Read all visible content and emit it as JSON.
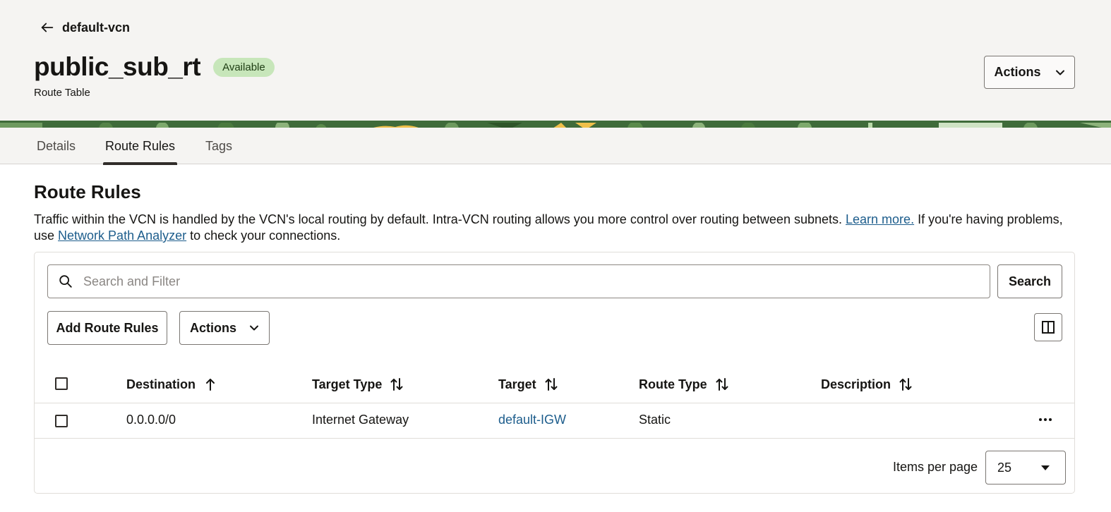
{
  "breadcrumb": {
    "back_label": "default-vcn"
  },
  "resource": {
    "name": "public_sub_rt",
    "status": "Available",
    "type": "Route Table",
    "actions_label": "Actions"
  },
  "tabs": [
    {
      "label": "Details",
      "active": false
    },
    {
      "label": "Route Rules",
      "active": true
    },
    {
      "label": "Tags",
      "active": false
    }
  ],
  "section": {
    "title": "Route Rules",
    "desc_part1": "Traffic within the VCN is handled by the VCN's local routing by default. Intra-VCN routing allows you more control over routing between subnets. ",
    "learn_more": "Learn more.",
    "desc_part2": " If you're having problems, use ",
    "analyzer_link": "Network Path Analyzer",
    "desc_part3": " to check your connections."
  },
  "toolbar": {
    "search_placeholder": "Search and Filter",
    "search_button": "Search",
    "add_button": "Add Route Rules",
    "actions_button": "Actions"
  },
  "table": {
    "columns": [
      {
        "label": "Destination",
        "sort": "ascending"
      },
      {
        "label": "Target Type",
        "sort": "none"
      },
      {
        "label": "Target",
        "sort": "none"
      },
      {
        "label": "Route Type",
        "sort": "none"
      },
      {
        "label": "Description",
        "sort": "none"
      }
    ],
    "rows": [
      {
        "destination": "0.0.0.0/0",
        "target_type": "Internet Gateway",
        "target": "default-IGW",
        "route_type": "Static",
        "description": ""
      }
    ]
  },
  "pagination": {
    "items_per_page_label": "Items per page",
    "items_per_page_value": "25"
  },
  "colors": {
    "header_bg": "#f5f4f2",
    "badge_bg": "#c7e6ba",
    "link": "#1d5d8c",
    "banner_green": "#3f6b3a",
    "banner_yellow": "#f0c04a"
  }
}
